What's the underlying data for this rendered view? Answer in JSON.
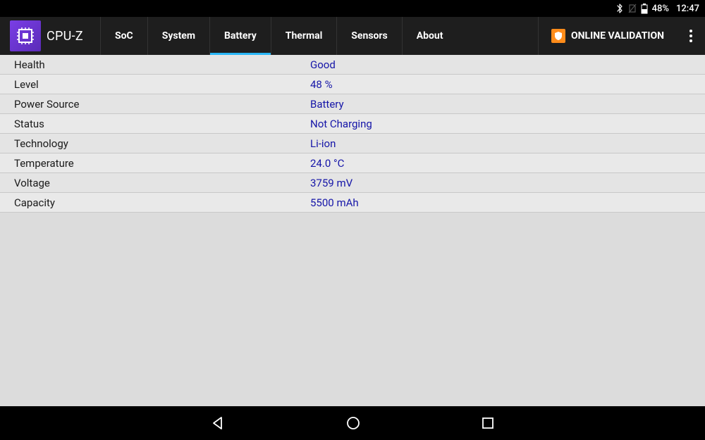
{
  "status": {
    "battery_pct": "48%",
    "time": "12:47"
  },
  "app": {
    "title": "CPU-Z",
    "online_validation": "ONLINE VALIDATION"
  },
  "tabs": [
    {
      "label": "SoC"
    },
    {
      "label": "System"
    },
    {
      "label": "Battery",
      "active": true
    },
    {
      "label": "Thermal"
    },
    {
      "label": "Sensors"
    },
    {
      "label": "About"
    }
  ],
  "rows": [
    {
      "label": "Health",
      "value": "Good"
    },
    {
      "label": "Level",
      "value": "48 %"
    },
    {
      "label": "Power Source",
      "value": "Battery"
    },
    {
      "label": "Status",
      "value": "Not Charging"
    },
    {
      "label": "Technology",
      "value": "Li-ion"
    },
    {
      "label": "Temperature",
      "value": "24.0 °C"
    },
    {
      "label": "Voltage",
      "value": "3759 mV"
    },
    {
      "label": "Capacity",
      "value": "5500 mAh"
    }
  ]
}
